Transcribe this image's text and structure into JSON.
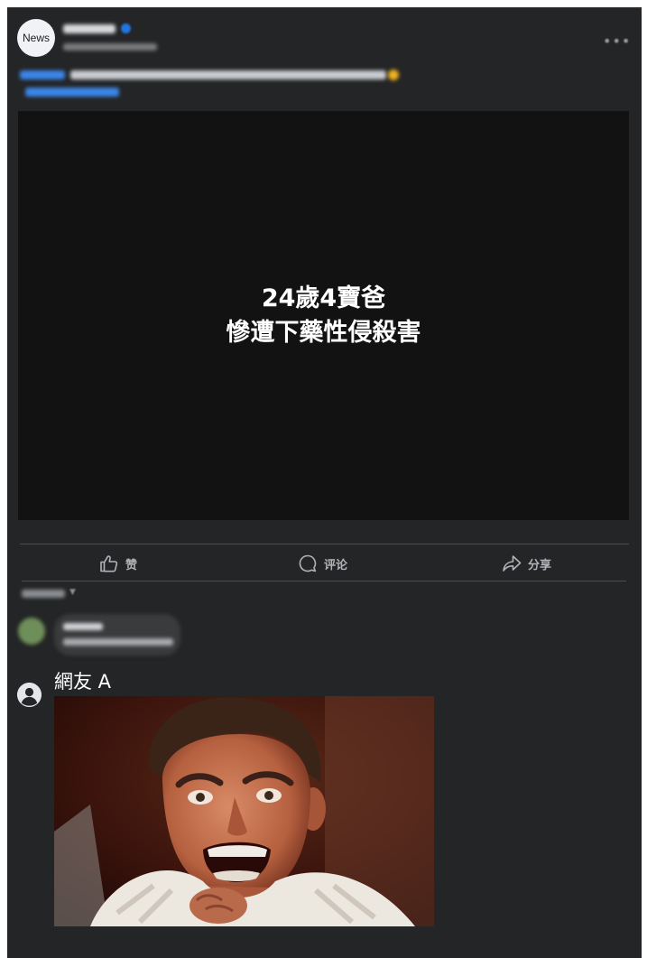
{
  "post": {
    "avatar_text": "News",
    "page_name": "",
    "timestamp": "",
    "caption": "",
    "menu_icon": "more-dots-icon",
    "verified_icon": "verified-badge-icon"
  },
  "video": {
    "headline_line1": "24歲4寶爸",
    "headline_line2": "慘遭下藥性侵殺害"
  },
  "actions": {
    "like_label": "赞",
    "comment_label": "评论",
    "share_label": "分享",
    "like_icon": "thumbs-up-icon",
    "comment_icon": "comment-bubble-icon",
    "share_icon": "share-arrow-icon"
  },
  "comments": {
    "sort_label": "",
    "first_comment_author": "",
    "first_comment_text": "",
    "second_comment_author": "網友 A",
    "second_comment_avatar_icon": "default-user-icon",
    "second_comment_image": "shouting-man-reaction-image"
  },
  "colors": {
    "card_background": "#242526",
    "video_background": "#121212",
    "secondary_text": "#b0b3b8",
    "link_blue": "#3b86e8",
    "verified_blue": "#2374e1"
  }
}
